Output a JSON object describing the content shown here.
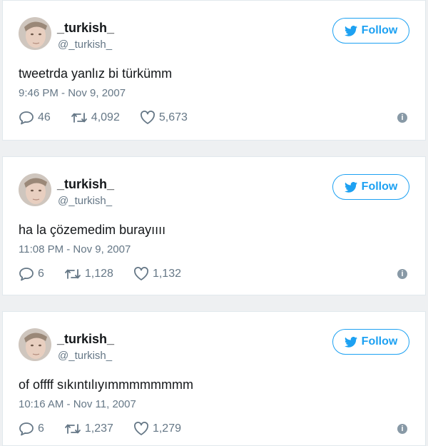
{
  "colors": {
    "accent": "#1da1f2",
    "muted": "#657786"
  },
  "tweets": [
    {
      "name": "_turkish_",
      "handle": "@_turkish_",
      "follow_label": "Follow",
      "text": "tweetrda yanlız bi türkümm",
      "time": "9:46 PM - Nov 9, 2007",
      "replies": "46",
      "retweets": "4,092",
      "likes": "5,673"
    },
    {
      "name": "_turkish_",
      "handle": "@_turkish_",
      "follow_label": "Follow",
      "text": "ha la çözemedim burayıııı",
      "time": "11:08 PM - Nov 9, 2007",
      "replies": "6",
      "retweets": "1,128",
      "likes": "1,132"
    },
    {
      "name": "_turkish_",
      "handle": "@_turkish_",
      "follow_label": "Follow",
      "text": "of offff sıkıntılıyımmmmmmmm",
      "time": "10:16 AM - Nov 11, 2007",
      "replies": "6",
      "retweets": "1,237",
      "likes": "1,279"
    }
  ]
}
